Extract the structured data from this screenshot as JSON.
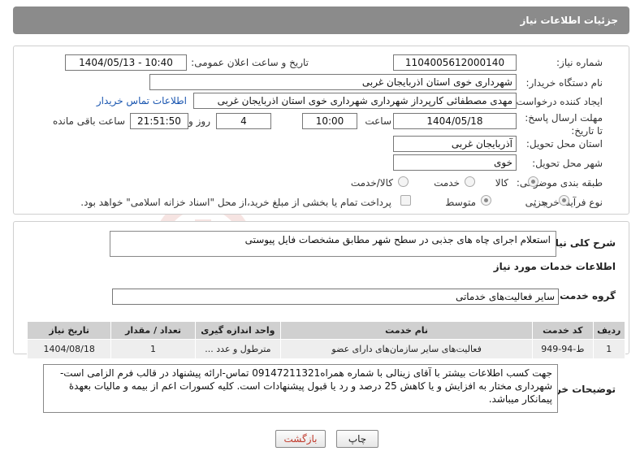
{
  "header": {
    "title": "جزئیات اطلاعات نیاز"
  },
  "fields": {
    "need_number_label": "شماره نیاز:",
    "need_number": "1104005612000140",
    "announce_label": "تاریخ و ساعت اعلان عمومی:",
    "announce_value": "1404/05/13 - 10:40",
    "buyer_org_label": "نام دستگاه خریدار:",
    "buyer_org": "شهرداری خوی استان اذربایجان غربی",
    "creator_label": "ایجاد کننده درخواست:",
    "creator": "مهدی مصطفائی کارپرداز شهرداری شهرداری خوی استان اذربایجان غربی",
    "contact_link": "اطلاعات تماس خریدار",
    "deadline_label": "مهلت ارسال پاسخ: تا تاریخ:",
    "deadline_date": "1404/05/18",
    "time_label": "ساعت",
    "deadline_time": "10:00",
    "days_value": "4",
    "days_label": "روز و",
    "remaining_time": "21:51:50",
    "remaining_label": "ساعت باقی مانده",
    "province_label": "استان محل تحویل:",
    "province": "آذربایجان غربی",
    "city_label": "شهر محل تحویل:",
    "city": "خوی",
    "category_label": "طبقه بندی موضوعی:",
    "category_options": [
      "کالا",
      "خدمت",
      "کالا/خدمت"
    ],
    "process_label": "نوع فرآیند خرید :",
    "process_options": [
      "جزیی",
      "متوسط"
    ],
    "payment_note": "پرداخت تمام یا بخشی از مبلغ خرید،از محل \"اسناد خزانه اسلامی\" خواهد بود."
  },
  "summary": {
    "label": "شرح کلی نیاز:",
    "text": "استعلام اجرای چاه های جذبی در سطح شهر مطابق مشخصات فایل پیوستی"
  },
  "services": {
    "section_title": "اطلاعات خدمات مورد نیاز",
    "group_label": "گروه خدمت:",
    "group_value": "سایر فعالیت‌های خدماتی",
    "columns": [
      "ردیف",
      "کد خدمت",
      "نام خدمت",
      "واحد اندازه گیری",
      "تعداد / مقدار",
      "تاریخ نیاز"
    ],
    "rows": [
      [
        "1",
        "ط-94-949",
        "فعالیت‌های سایر سازمان‌های دارای عضو",
        "مترطول و عدد ...",
        "1",
        "1404/08/18"
      ]
    ]
  },
  "buyer_notes": {
    "label": "توضیحات خریدار:",
    "text": "جهت کسب اطلاعات بیشتر با آقای زینالی با شماره همراه09147211321 تماس-ارائه پیشنهاد در قالب فرم الزامی است-شهرداری مختار به افزایش و یا کاهش 25 درصد و رد یا قبول پیشنهادات است. کلیه کسورات اعم از بیمه و مالیات بعهدۀ پیمانکار میباشد."
  },
  "buttons": {
    "print": "چاپ",
    "back": "بازگشت"
  },
  "watermark": {
    "text": "AriaTender.net"
  },
  "colors": {
    "header_bg": "#8b8b8b",
    "link": "#1a56b0",
    "back_text": "#c0392b"
  }
}
